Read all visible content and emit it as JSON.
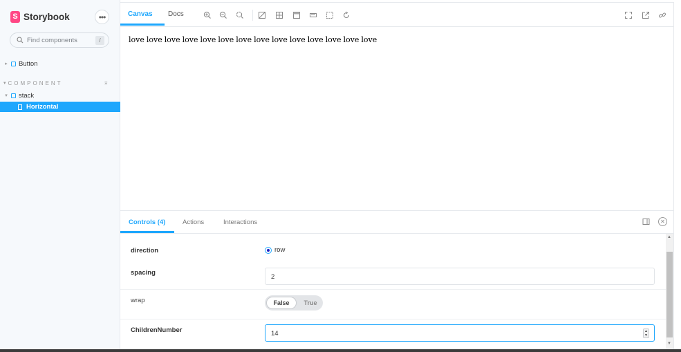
{
  "brand": {
    "logo_letter": "S",
    "name": "Storybook"
  },
  "sidebar": {
    "menu_label": "•••",
    "search": {
      "placeholder": "Find components",
      "shortcut": "/"
    },
    "top_items": [
      {
        "label": "Button"
      }
    ],
    "section": {
      "title": "COMPONENT",
      "collapse_glyph": "⌅"
    },
    "groups": [
      {
        "label": "stack",
        "stories": [
          {
            "label": "Horizontal",
            "selected": true
          }
        ]
      }
    ]
  },
  "toolbar": {
    "tabs": [
      {
        "label": "Canvas",
        "active": true
      },
      {
        "label": "Docs",
        "active": false
      }
    ]
  },
  "canvas": {
    "direction": "row",
    "items": [
      "love",
      "love",
      "love",
      "love",
      "love",
      "love",
      "love",
      "love",
      "love",
      "love",
      "love",
      "love",
      "love",
      "love"
    ]
  },
  "addons": {
    "tabs": [
      {
        "label": "Controls (4)",
        "active": true
      },
      {
        "label": "Actions",
        "active": false
      },
      {
        "label": "Interactions",
        "active": false
      }
    ],
    "controls": {
      "direction": {
        "name": "direction",
        "option": "row",
        "selected": true
      },
      "spacing": {
        "name": "spacing",
        "value": "2"
      },
      "wrap": {
        "name": "wrap",
        "false_label": "False",
        "true_label": "True",
        "value": false
      },
      "children": {
        "name": "ChildrenNumber",
        "value": "14"
      }
    }
  },
  "colors": {
    "accent": "#1ea7fd",
    "brand": "#ff4785",
    "sidebar_bg": "#f6f9fc"
  }
}
